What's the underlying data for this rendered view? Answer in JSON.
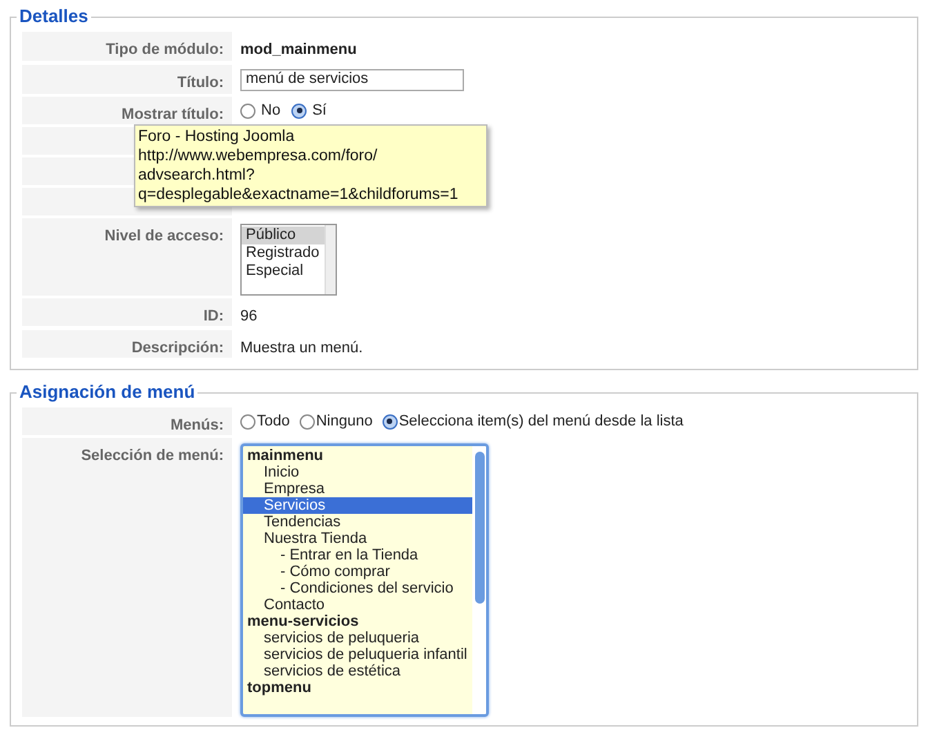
{
  "details": {
    "legend": "Detalles",
    "rows": [
      {
        "kind": "text",
        "label": "Tipo de módulo:",
        "value": "mod_mainmenu"
      },
      {
        "kind": "input",
        "label": "Título:",
        "value": "menú de servicios"
      },
      {
        "kind": "radio",
        "label": "Mostrar título:",
        "options": [
          {
            "label": "No",
            "selected": false
          },
          {
            "label": "Sí",
            "selected": true
          }
        ]
      },
      {
        "kind": "covered"
      },
      {
        "kind": "covered"
      },
      {
        "kind": "covered"
      },
      {
        "kind": "listbox",
        "label": "Nivel de acceso:",
        "options": [
          {
            "label": "Público",
            "selected": true
          },
          {
            "label": "Registrado",
            "selected": false
          },
          {
            "label": "Especial",
            "selected": false
          }
        ]
      },
      {
        "kind": "plain",
        "label": "ID:",
        "value": "96"
      },
      {
        "kind": "plain",
        "label": "Descripción:",
        "value": "Muestra un menú."
      }
    ]
  },
  "tooltip": {
    "lines": [
      "Foro - Hosting Joomla",
      "http://www.webempresa.com/foro/",
      "advsearch.html?",
      "q=desplegable&exactname=1&childforums=1"
    ]
  },
  "assignment": {
    "legend": "Asignación de menú",
    "menus": {
      "label": "Menús:",
      "options": [
        {
          "label": "Todo",
          "selected": false
        },
        {
          "label": "Ninguno",
          "selected": false
        },
        {
          "label": "Selecciona item(s) del menú desde la lista",
          "selected": true
        }
      ]
    },
    "selection": {
      "label": "Selección de menú:",
      "items": [
        {
          "label": "mainmenu",
          "selected": false,
          "children": [
            {
              "label": "Inicio",
              "selected": false
            },
            {
              "label": "Empresa",
              "selected": false
            },
            {
              "label": "Servicios",
              "selected": true
            },
            {
              "label": "Tendencias",
              "selected": false
            },
            {
              "label": "Nuestra Tienda",
              "selected": false,
              "children": [
                {
                  "label": "- Entrar en la Tienda",
                  "selected": false
                },
                {
                  "label": "- Cómo comprar",
                  "selected": false
                },
                {
                  "label": "- Condiciones del servicio",
                  "selected": false
                }
              ]
            },
            {
              "label": "Contacto",
              "selected": false
            }
          ]
        },
        {
          "label": "menu-servicios",
          "selected": false,
          "children": [
            {
              "label": "servicios de peluqueria",
              "selected": false
            },
            {
              "label": "servicios de peluqueria infantil",
              "selected": false
            },
            {
              "label": "servicios de estética",
              "selected": false
            }
          ]
        },
        {
          "label": "topmenu",
          "selected": false
        }
      ]
    }
  }
}
